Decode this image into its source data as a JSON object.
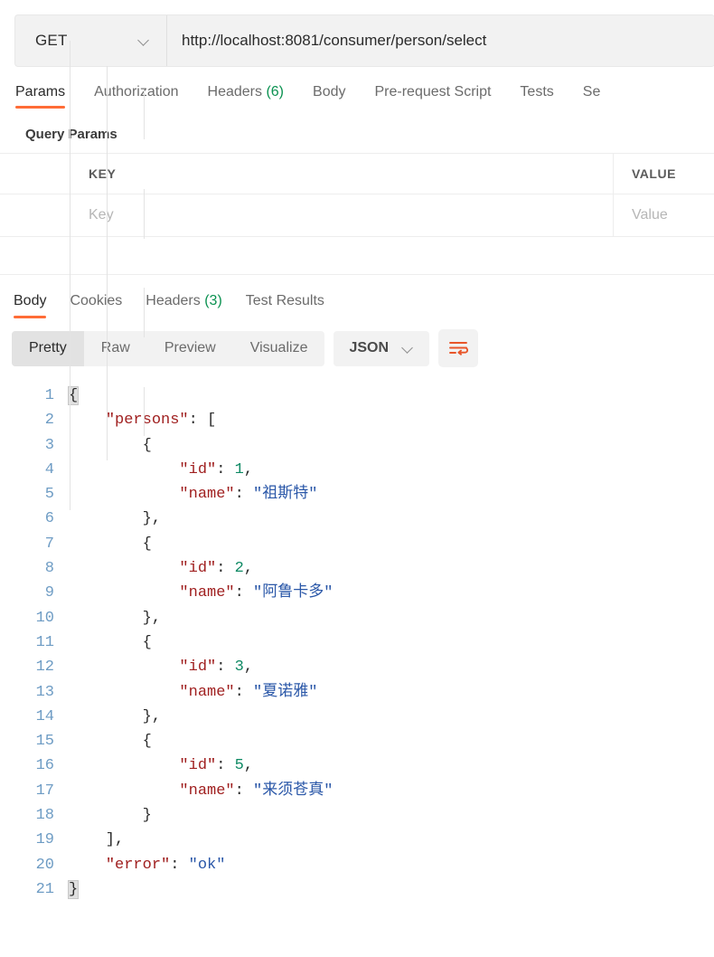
{
  "request": {
    "method": "GET",
    "method_caret_icon": "chevron-down-icon",
    "url": "http://localhost:8081/consumer/person/select",
    "tabs": [
      {
        "label": "Params",
        "active": true
      },
      {
        "label": "Authorization",
        "active": false
      },
      {
        "label": "Headers",
        "count": "(6)",
        "active": false
      },
      {
        "label": "Body",
        "active": false
      },
      {
        "label": "Pre-request Script",
        "active": false
      },
      {
        "label": "Tests",
        "active": false
      },
      {
        "label": "Se",
        "active": false
      }
    ]
  },
  "query_params": {
    "title": "Query Params",
    "columns": {
      "key": "KEY",
      "value": "VALUE"
    },
    "rows": [
      {
        "key_placeholder": "Key",
        "value_placeholder": "Value"
      }
    ]
  },
  "response": {
    "tabs": [
      {
        "label": "Body",
        "active": true
      },
      {
        "label": "Cookies",
        "active": false
      },
      {
        "label": "Headers",
        "count": "(3)",
        "active": false
      },
      {
        "label": "Test Results",
        "active": false
      }
    ],
    "view_modes": [
      {
        "label": "Pretty",
        "active": true
      },
      {
        "label": "Raw",
        "active": false
      },
      {
        "label": "Preview",
        "active": false
      },
      {
        "label": "Visualize",
        "active": false
      }
    ],
    "format": "JSON",
    "format_caret_icon": "chevron-down-icon",
    "wrap_icon": "word-wrap-icon",
    "accent_color": "#ff6c37",
    "body_lines": [
      {
        "num": "1",
        "segments": [
          {
            "t": "{",
            "c": "p",
            "brace": true
          }
        ]
      },
      {
        "num": "2",
        "segments": [
          {
            "t": "    ",
            "c": "p"
          },
          {
            "t": "\"persons\"",
            "c": "k"
          },
          {
            "t": ": [",
            "c": "p"
          }
        ]
      },
      {
        "num": "3",
        "segments": [
          {
            "t": "        {",
            "c": "p"
          }
        ]
      },
      {
        "num": "4",
        "segments": [
          {
            "t": "            ",
            "c": "p"
          },
          {
            "t": "\"id\"",
            "c": "k"
          },
          {
            "t": ": ",
            "c": "p"
          },
          {
            "t": "1",
            "c": "n"
          },
          {
            "t": ",",
            "c": "p"
          }
        ]
      },
      {
        "num": "5",
        "segments": [
          {
            "t": "            ",
            "c": "p"
          },
          {
            "t": "\"name\"",
            "c": "k"
          },
          {
            "t": ": ",
            "c": "p"
          },
          {
            "t": "\"祖斯特\"",
            "c": "s"
          }
        ]
      },
      {
        "num": "6",
        "segments": [
          {
            "t": "        },",
            "c": "p"
          }
        ]
      },
      {
        "num": "7",
        "segments": [
          {
            "t": "        {",
            "c": "p"
          }
        ]
      },
      {
        "num": "8",
        "segments": [
          {
            "t": "            ",
            "c": "p"
          },
          {
            "t": "\"id\"",
            "c": "k"
          },
          {
            "t": ": ",
            "c": "p"
          },
          {
            "t": "2",
            "c": "n"
          },
          {
            "t": ",",
            "c": "p"
          }
        ]
      },
      {
        "num": "9",
        "segments": [
          {
            "t": "            ",
            "c": "p"
          },
          {
            "t": "\"name\"",
            "c": "k"
          },
          {
            "t": ": ",
            "c": "p"
          },
          {
            "t": "\"阿鲁卡多\"",
            "c": "s"
          }
        ]
      },
      {
        "num": "10",
        "segments": [
          {
            "t": "        },",
            "c": "p"
          }
        ]
      },
      {
        "num": "11",
        "segments": [
          {
            "t": "        {",
            "c": "p"
          }
        ]
      },
      {
        "num": "12",
        "segments": [
          {
            "t": "            ",
            "c": "p"
          },
          {
            "t": "\"id\"",
            "c": "k"
          },
          {
            "t": ": ",
            "c": "p"
          },
          {
            "t": "3",
            "c": "n"
          },
          {
            "t": ",",
            "c": "p"
          }
        ]
      },
      {
        "num": "13",
        "segments": [
          {
            "t": "            ",
            "c": "p"
          },
          {
            "t": "\"name\"",
            "c": "k"
          },
          {
            "t": ": ",
            "c": "p"
          },
          {
            "t": "\"夏诺雅\"",
            "c": "s"
          }
        ]
      },
      {
        "num": "14",
        "segments": [
          {
            "t": "        },",
            "c": "p"
          }
        ]
      },
      {
        "num": "15",
        "segments": [
          {
            "t": "        {",
            "c": "p"
          }
        ]
      },
      {
        "num": "16",
        "segments": [
          {
            "t": "            ",
            "c": "p"
          },
          {
            "t": "\"id\"",
            "c": "k"
          },
          {
            "t": ": ",
            "c": "p"
          },
          {
            "t": "5",
            "c": "n"
          },
          {
            "t": ",",
            "c": "p"
          }
        ]
      },
      {
        "num": "17",
        "segments": [
          {
            "t": "            ",
            "c": "p"
          },
          {
            "t": "\"name\"",
            "c": "k"
          },
          {
            "t": ": ",
            "c": "p"
          },
          {
            "t": "\"来须苍真\"",
            "c": "s"
          }
        ]
      },
      {
        "num": "18",
        "segments": [
          {
            "t": "        }",
            "c": "p"
          }
        ]
      },
      {
        "num": "19",
        "segments": [
          {
            "t": "    ],",
            "c": "p"
          }
        ]
      },
      {
        "num": "20",
        "segments": [
          {
            "t": "    ",
            "c": "p"
          },
          {
            "t": "\"error\"",
            "c": "k"
          },
          {
            "t": ": ",
            "c": "p"
          },
          {
            "t": "\"ok\"",
            "c": "s"
          }
        ]
      },
      {
        "num": "21",
        "segments": [
          {
            "t": "}",
            "c": "p",
            "brace": true
          }
        ]
      }
    ]
  }
}
